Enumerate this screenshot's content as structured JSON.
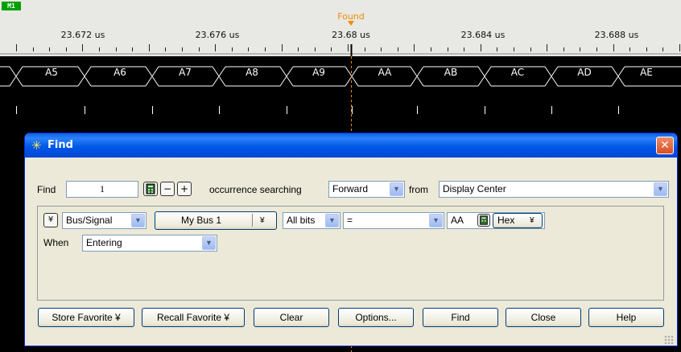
{
  "ruler": {
    "marker_label": "M1",
    "found_label": "Found",
    "time_labels": [
      "23.672 us",
      "23.676 us",
      "23.68 us",
      "23.684 us",
      "23.688 us"
    ]
  },
  "bus": {
    "values": [
      "A5",
      "A6",
      "A7",
      "A8",
      "A9",
      "AA",
      "AB",
      "AC",
      "AD",
      "AE"
    ]
  },
  "colors": {
    "found_marker": "#f08c00",
    "waveform": "#ffffff",
    "background": "#000000",
    "dialog_title": "#0058e6"
  },
  "dialog": {
    "title": "Find",
    "title_icon": "sparkle-icon",
    "close_label": "✕",
    "find_label": "Find",
    "occurrence_value": "1",
    "calc_icon": "calculator-icon",
    "minus_label": "−",
    "plus_label": "+",
    "occurrence_text": "occurrence searching",
    "direction_value": "Forward",
    "from_label": "from",
    "from_value": "Display Center",
    "criteria": {
      "expand_label": "¥",
      "type_value": "Bus/Signal",
      "bus_value": "My Bus 1",
      "bus_menu_label": "¥",
      "bits_value": "All bits",
      "operator_value": "=",
      "pattern_value": "AA",
      "format_value": "Hex",
      "format_menu_label": "¥",
      "when_label": "When",
      "when_value": "Entering"
    },
    "buttons": {
      "store_favorite": "Store Favorite ¥",
      "recall_favorite": "Recall Favorite ¥",
      "clear": "Clear",
      "options": "Options...",
      "find": "Find",
      "close": "Close",
      "help": "Help"
    }
  }
}
